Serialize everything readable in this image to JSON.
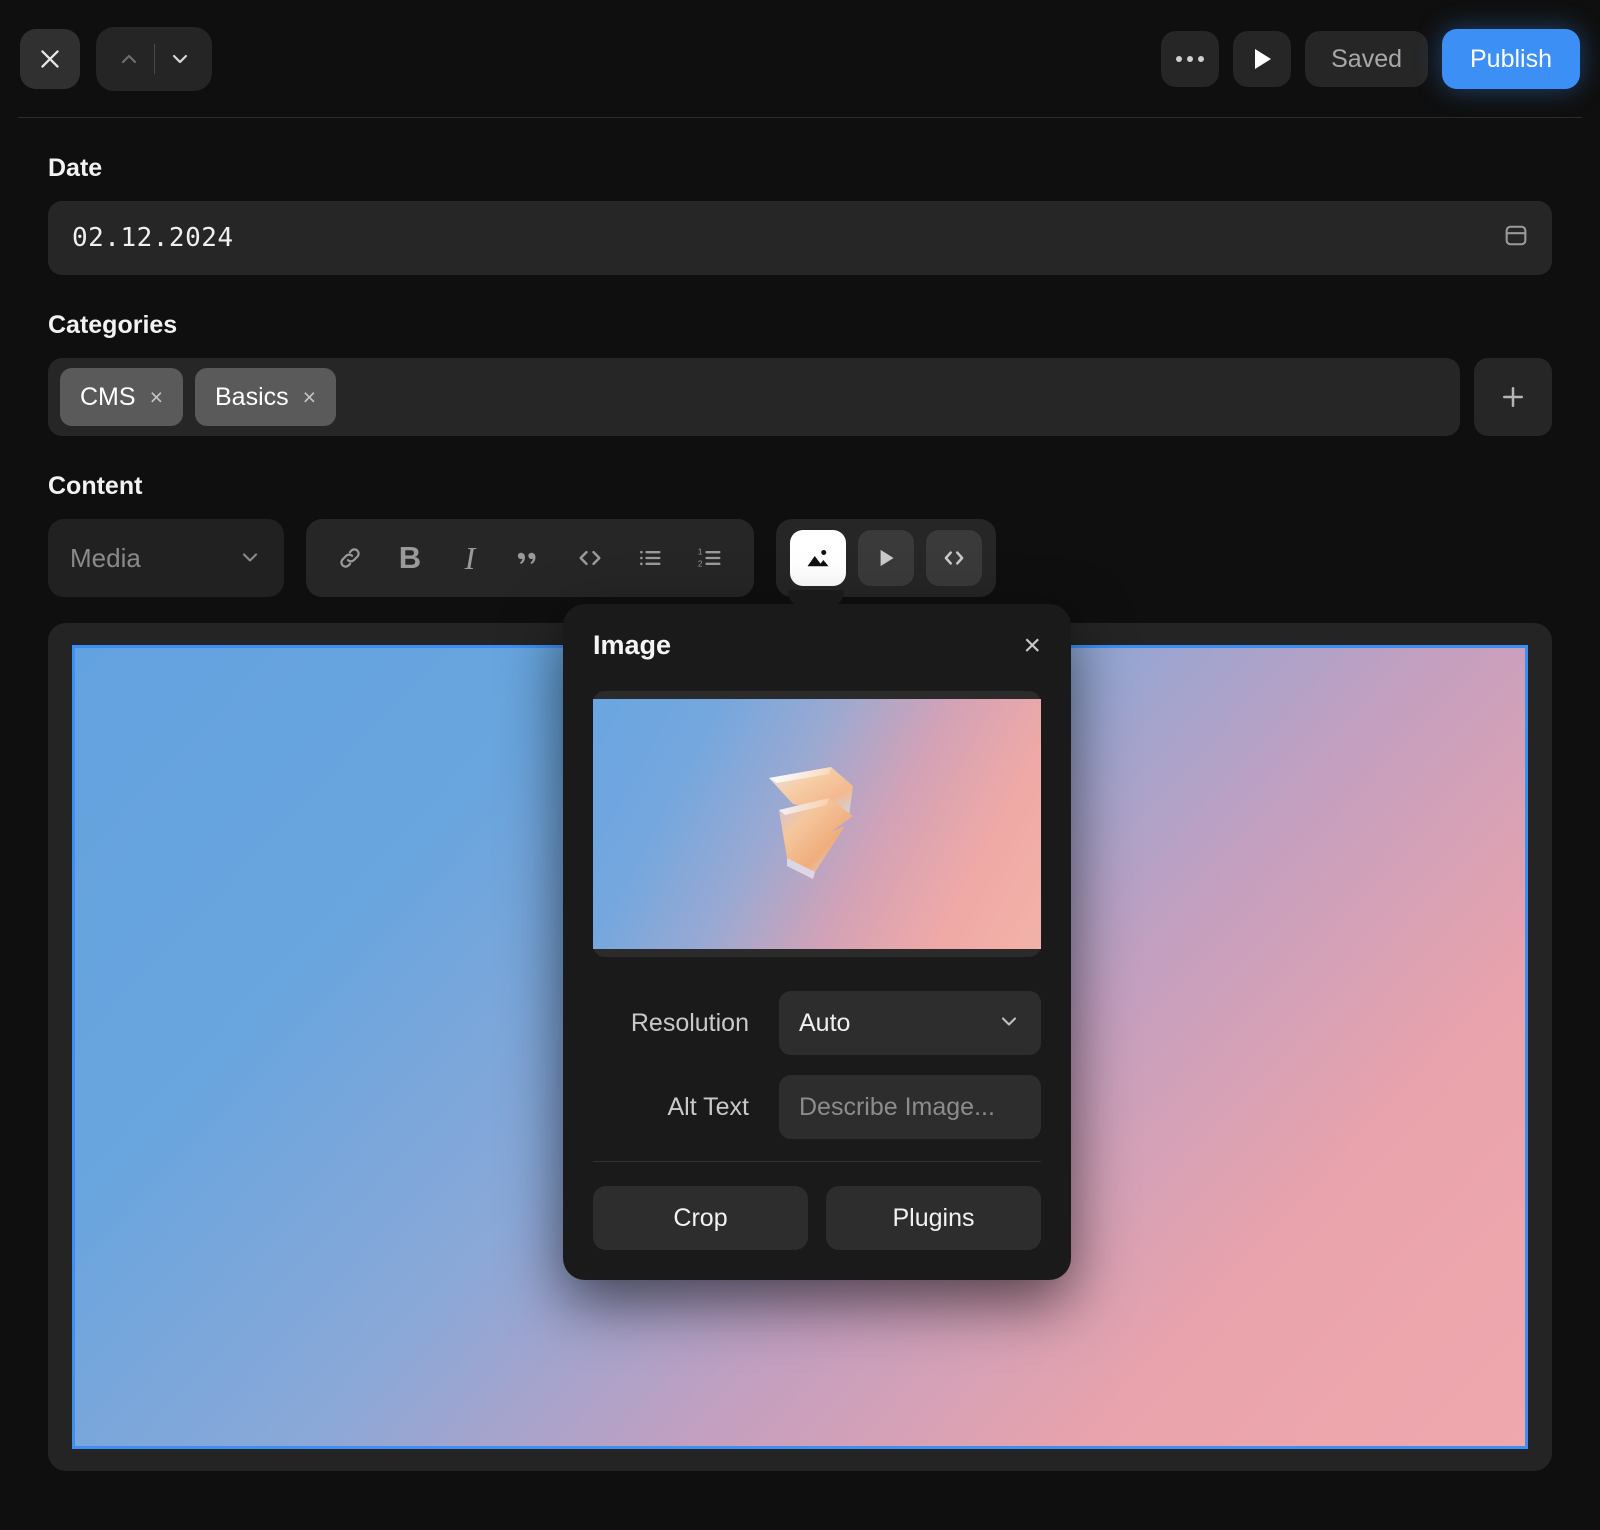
{
  "header": {
    "close_label": "×",
    "nav_prev_icon": "chevron-up-icon",
    "nav_next_icon": "chevron-down-icon",
    "more_icon": "ellipsis-icon",
    "preview_icon": "play-icon",
    "saved_label": "Saved",
    "publish_label": "Publish",
    "accent_color": "#3b8ff5"
  },
  "fields": {
    "date": {
      "label": "Date",
      "value": "02.12.2024",
      "icon": "calendar-icon"
    },
    "categories": {
      "label": "Categories",
      "chips": [
        {
          "label": "CMS",
          "remove": "×"
        },
        {
          "label": "Basics",
          "remove": "×"
        }
      ],
      "add_label": "+"
    },
    "content": {
      "label": "Content"
    }
  },
  "toolbar": {
    "media_select": {
      "value": "Media",
      "caret_icon": "chevron-down-icon"
    },
    "format_tools": [
      {
        "name": "link-icon",
        "glyph": ""
      },
      {
        "name": "bold-icon",
        "glyph": "B"
      },
      {
        "name": "italic-icon",
        "glyph": "I"
      },
      {
        "name": "quote-icon",
        "glyph": ""
      },
      {
        "name": "code-icon",
        "glyph": ""
      },
      {
        "name": "bullet-list-icon",
        "glyph": ""
      },
      {
        "name": "numbered-list-icon",
        "glyph": ""
      }
    ],
    "media_tools": [
      {
        "name": "image-icon",
        "active": true
      },
      {
        "name": "video-icon",
        "active": false
      },
      {
        "name": "embed-code-icon",
        "active": false
      }
    ]
  },
  "canvas": {
    "selected_image_alt": "gradient image with glass shape",
    "selection_color": "#3b8ff5"
  },
  "popover": {
    "title": "Image",
    "close_label": "×",
    "thumbnail_alt": "glass S shape on blue to pink gradient",
    "rows": [
      {
        "label": "Resolution",
        "type": "select",
        "value": "Auto",
        "caret_icon": "chevron-down-icon"
      },
      {
        "label": "Alt Text",
        "type": "input",
        "value": "",
        "placeholder": "Describe Image..."
      }
    ],
    "actions": [
      {
        "label": "Crop"
      },
      {
        "label": "Plugins"
      }
    ]
  }
}
